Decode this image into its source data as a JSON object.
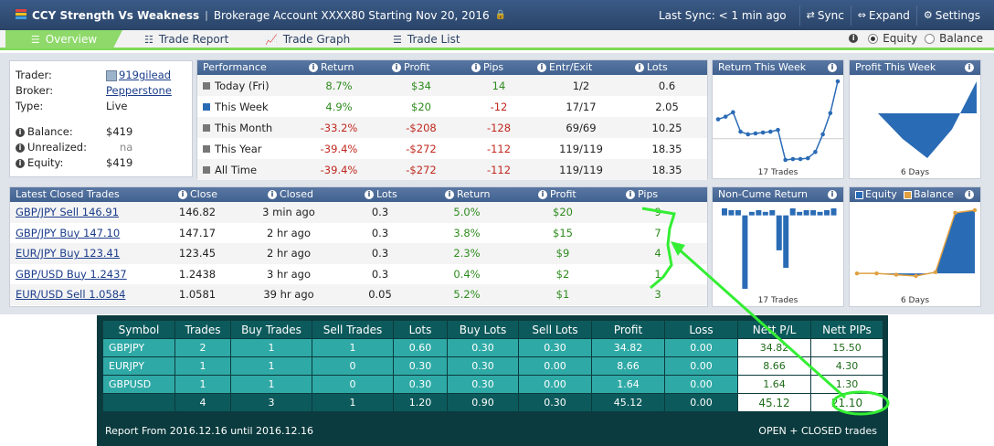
{
  "header": {
    "title": "CCY Strength Vs Weakness",
    "subtitle": "Brokerage Account XXXX80 Starting Nov 20, 2016",
    "last_sync": "Last Sync: < 1 min ago",
    "sync_label": "Sync",
    "expand_label": "Expand",
    "settings_label": "Settings"
  },
  "tabs": [
    {
      "label": "Overview"
    },
    {
      "label": "Trade Report"
    },
    {
      "label": "Trade Graph"
    },
    {
      "label": "Trade List"
    }
  ],
  "view_toggle": {
    "equity": "Equity",
    "balance": "Balance",
    "selected": "Equity"
  },
  "trader_info": {
    "trader_label": "Trader:",
    "trader": "919gilead",
    "broker_label": "Broker:",
    "broker": "Pepperstone",
    "type_label": "Type:",
    "type": "Live",
    "balance_label": "Balance:",
    "balance": "$419",
    "unrealized_label": "Unrealized:",
    "unrealized": "na",
    "equity_label": "Equity:",
    "equity": "$419"
  },
  "performance": {
    "headers": [
      "Performance",
      "Return",
      "Profit",
      "Pips",
      "Entr/Exit",
      "Lots"
    ],
    "rows": [
      {
        "period": "Today (Fri)",
        "ret": "8.7%",
        "profit": "$34",
        "pips": "14",
        "entr": "1/2",
        "lots": "0.6"
      },
      {
        "period": "This Week",
        "ret": "4.9%",
        "profit": "$20",
        "pips": "-12",
        "entr": "17/17",
        "lots": "2.05"
      },
      {
        "period": "This Month",
        "ret": "-33.2%",
        "profit": "-$208",
        "pips": "-128",
        "entr": "69/69",
        "lots": "10.25"
      },
      {
        "period": "This Year",
        "ret": "-39.4%",
        "profit": "-$272",
        "pips": "-112",
        "entr": "119/119",
        "lots": "18.35"
      },
      {
        "period": "All Time",
        "ret": "-39.4%",
        "profit": "-$272",
        "pips": "-112",
        "entr": "119/119",
        "lots": "18.35"
      }
    ]
  },
  "closed_trades": {
    "headers": [
      "Latest Closed Trades",
      "Close",
      "Closed",
      "Lots",
      "Return",
      "Profit",
      "Pips"
    ],
    "rows": [
      {
        "trade": "GBP/JPY Sell 146.91",
        "close": "146.82",
        "closed": "3 min ago",
        "lots": "0.3",
        "ret": "5.0%",
        "profit": "$20",
        "pips": "9"
      },
      {
        "trade": "GBP/JPY Buy 147.10",
        "close": "147.17",
        "closed": "2 hr ago",
        "lots": "0.3",
        "ret": "3.8%",
        "profit": "$15",
        "pips": "7"
      },
      {
        "trade": "EUR/JPY Buy 123.41",
        "close": "123.45",
        "closed": "2 hr ago",
        "lots": "0.3",
        "ret": "2.3%",
        "profit": "$9",
        "pips": "4"
      },
      {
        "trade": "GBP/USD Buy 1.2437",
        "close": "1.2438",
        "closed": "3 hr ago",
        "lots": "0.3",
        "ret": "0.4%",
        "profit": "$2",
        "pips": "1"
      },
      {
        "trade": "EUR/USD Sell 1.0584",
        "close": "1.0581",
        "closed": "39 hr ago",
        "lots": "0.05",
        "ret": "5.2%",
        "profit": "$1",
        "pips": "3"
      }
    ]
  },
  "mini_charts": {
    "return_week": {
      "title": "Return This Week",
      "footer": "17 Trades"
    },
    "profit_week": {
      "title": "Profit This Week",
      "footer": "6 Days"
    },
    "non_cume": {
      "title": "Non-Cume Return",
      "footer": "17 Trades"
    },
    "equity_balance": {
      "equity": "Equity",
      "balance": "Balance",
      "footer": "6 Days"
    }
  },
  "chart_data": [
    {
      "type": "line",
      "title": "Return This Week",
      "xlabel": "17 Trades",
      "values": [
        2.2,
        2.5,
        3.0,
        0.8,
        0.5,
        0.6,
        0.7,
        0.8,
        1.0,
        -2.4,
        -2.3,
        -2.3,
        -2.2,
        -1.5,
        0.5,
        2.9,
        6.5
      ]
    },
    {
      "type": "area",
      "title": "Profit This Week",
      "xlabel": "6 Days",
      "values": [
        0,
        0,
        -16,
        -28,
        -10,
        20
      ]
    },
    {
      "type": "bar",
      "title": "Non-Cume Return",
      "xlabel": "17 Trades",
      "values": [
        0.4,
        0.3,
        0.3,
        -4.2,
        0.2,
        0.3,
        0.2,
        0.3,
        -2.0,
        -3.0,
        0.4,
        0.2,
        0.3,
        0.3,
        0.2,
        0.3,
        0.4
      ]
    },
    {
      "type": "area",
      "xlabel": "6 Days",
      "series": [
        {
          "name": "Equity",
          "values": [
            0,
            0,
            -1,
            -2,
            1,
            47,
            49
          ]
        },
        {
          "name": "Balance",
          "values": [
            0,
            0,
            -1,
            -2,
            1,
            47,
            49
          ]
        }
      ]
    }
  ],
  "report": {
    "headers": [
      "Symbol",
      "Trades",
      "Buy Trades",
      "Sell Trades",
      "Lots",
      "Buy Lots",
      "Sell Lots",
      "Profit",
      "Loss",
      "Nett P/L",
      "Nett PIPs"
    ],
    "rows": [
      [
        "GBPJPY",
        "2",
        "1",
        "1",
        "0.60",
        "0.30",
        "0.30",
        "34.82",
        "0.00",
        "34.82",
        "15.50"
      ],
      [
        "EURJPY",
        "1",
        "1",
        "0",
        "0.30",
        "0.30",
        "0.00",
        "8.66",
        "0.00",
        "8.66",
        "4.30"
      ],
      [
        "GBPUSD",
        "1",
        "1",
        "0",
        "0.30",
        "0.30",
        "0.00",
        "1.64",
        "0.00",
        "1.64",
        "1.30"
      ]
    ],
    "total": [
      "",
      "4",
      "3",
      "1",
      "1.20",
      "0.90",
      "0.30",
      "45.12",
      "0.00",
      "45.12",
      "21.10"
    ],
    "footer_left": "Report From 2016.12.16 until 2016.12.16",
    "footer_right": "OPEN + CLOSED trades"
  },
  "colors": {
    "header_bg": "#40618f",
    "tab_accent": "#8ed96a",
    "positive": "#2e8b1e",
    "negative": "#c0281f",
    "chart_blue": "#2a6bb5",
    "report_bg": "#0b3b3e",
    "report_row": "#2fa9a6",
    "annotation": "#33ee33"
  }
}
